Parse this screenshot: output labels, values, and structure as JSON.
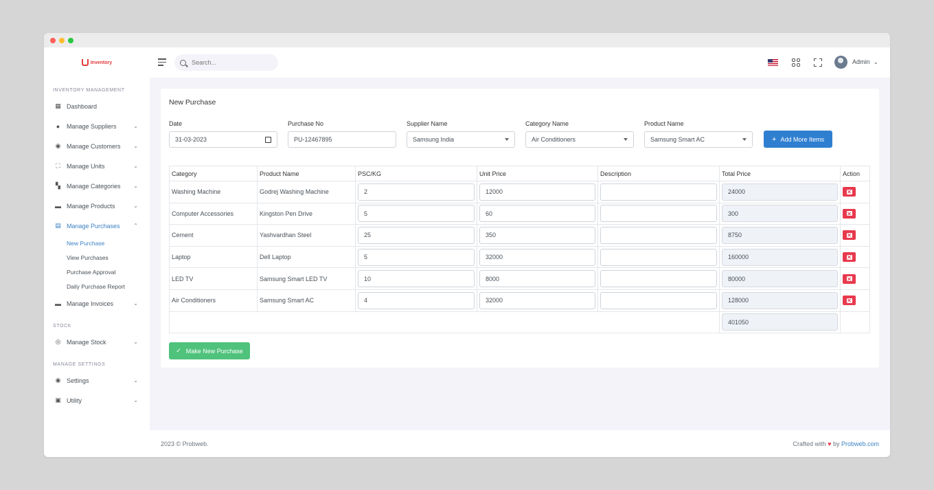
{
  "app": {
    "logo_text": "Inventory",
    "search_placeholder": "Search...",
    "user_name": "Admin"
  },
  "sidebar": {
    "sections": {
      "inventory": "INVENTORY MANAGEMENT",
      "stock": "STOCK",
      "settings": "MANAGE SETTINGS"
    },
    "items": [
      {
        "label": "Dashboard",
        "icon": "dashboard-icon"
      },
      {
        "label": "Manage Suppliers",
        "icon": "user-icon"
      },
      {
        "label": "Manage Customers",
        "icon": "customer-icon"
      },
      {
        "label": "Manage Units",
        "icon": "units-icon"
      },
      {
        "label": "Manage Categories",
        "icon": "categories-icon"
      },
      {
        "label": "Manage Products",
        "icon": "products-icon"
      },
      {
        "label": "Manage Purchases",
        "icon": "purchases-icon"
      },
      {
        "label": "Manage Invoices",
        "icon": "invoices-icon"
      },
      {
        "label": "Manage Stock",
        "icon": "stock-icon"
      },
      {
        "label": "Settings",
        "icon": "settings-icon"
      },
      {
        "label": "Utility",
        "icon": "utility-icon"
      }
    ],
    "purchases_sub": [
      "New Purchase",
      "View Purchases",
      "Purchase Approval",
      "Daily Purchase Report"
    ]
  },
  "form": {
    "title": "New Purchase",
    "date_label": "Date",
    "date_value": "31-03-2023",
    "purchase_no_label": "Purchase No",
    "purchase_no_value": "PU-12467895",
    "supplier_label": "Supplier Name",
    "supplier_value": "Samsung India",
    "category_label": "Category Name",
    "category_value": "Air Conditioners",
    "product_label": "Product Name",
    "product_value": "Samsung Smart AC",
    "add_button": "Add More Items",
    "submit_button": "Make New Purchase"
  },
  "table": {
    "headers": [
      "Category",
      "Product Name",
      "PSC/KG",
      "Unit Price",
      "Description",
      "Total Price",
      "Action"
    ],
    "rows": [
      {
        "category": "Washing Machine",
        "product": "Godrej Washing Machine",
        "qty": "2",
        "unit_price": "12000",
        "description": "",
        "total": "24000"
      },
      {
        "category": "Computer Accessories",
        "product": "Kingston Pen Drive",
        "qty": "5",
        "unit_price": "60",
        "description": "",
        "total": "300"
      },
      {
        "category": "Cement",
        "product": "Yashvardhan Steel",
        "qty": "25",
        "unit_price": "350",
        "description": "",
        "total": "8750"
      },
      {
        "category": "Laptop",
        "product": "Dell Laptop",
        "qty": "5",
        "unit_price": "32000",
        "description": "",
        "total": "160000"
      },
      {
        "category": "LED TV",
        "product": "Samsung Smart LED TV",
        "qty": "10",
        "unit_price": "8000",
        "description": "",
        "total": "80000"
      },
      {
        "category": "Air Conditioners",
        "product": "Samsung Smart AC",
        "qty": "4",
        "unit_price": "32000",
        "description": "",
        "total": "128000"
      }
    ],
    "grand_total": "401050"
  },
  "footer": {
    "copyright": "2023 © Probweb.",
    "crafted_prefix": "Crafted with",
    "crafted_by": "by",
    "crafted_link": "Probweb.com"
  },
  "colors": {
    "accent": "#3b82c4",
    "success": "#4fc27b",
    "danger": "#e8394d"
  }
}
